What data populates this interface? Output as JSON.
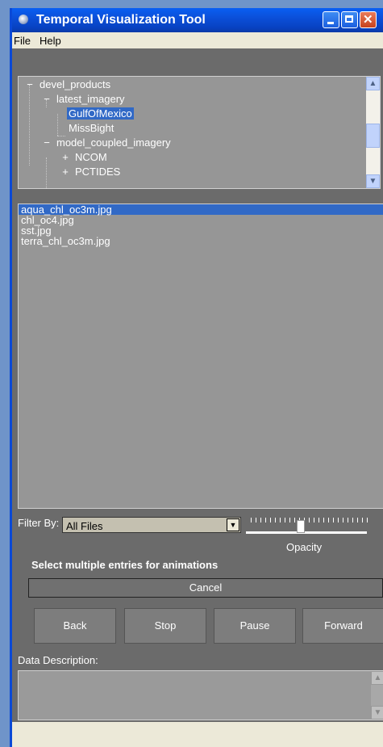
{
  "window": {
    "title": "Temporal Visualization Tool",
    "colors": {
      "titlebar": "#0b4fd9",
      "selection": "#3169c6",
      "panel": "#6b6b6b"
    }
  },
  "menu": {
    "file": "File",
    "help": "Help"
  },
  "tree": {
    "toggle_collapse": "−",
    "toggle_expand": "+",
    "nodes": [
      {
        "label": "devel_products"
      },
      {
        "label": "latest_imagery"
      },
      {
        "label": "GulfOfMexico",
        "selected": true
      },
      {
        "label": "MissBight"
      },
      {
        "label": "model_coupled_imagery"
      },
      {
        "label": "NCOM"
      },
      {
        "label": "PCTIDES"
      }
    ]
  },
  "files": [
    {
      "name": "aqua_chl_oc3m.jpg",
      "selected": true
    },
    {
      "name": "chl_oc4.jpg"
    },
    {
      "name": "sst.jpg"
    },
    {
      "name": "terra_chl_oc3m.jpg"
    }
  ],
  "filter": {
    "label": "Filter By:",
    "value": "All Files"
  },
  "opacity": {
    "label": "Opacity"
  },
  "hint": "Select multiple entries for animations",
  "buttons": {
    "cancel": "Cancel",
    "back": "Back",
    "stop": "Stop",
    "pause": "Pause",
    "forward": "Forward"
  },
  "description": {
    "label": "Data Description:"
  }
}
